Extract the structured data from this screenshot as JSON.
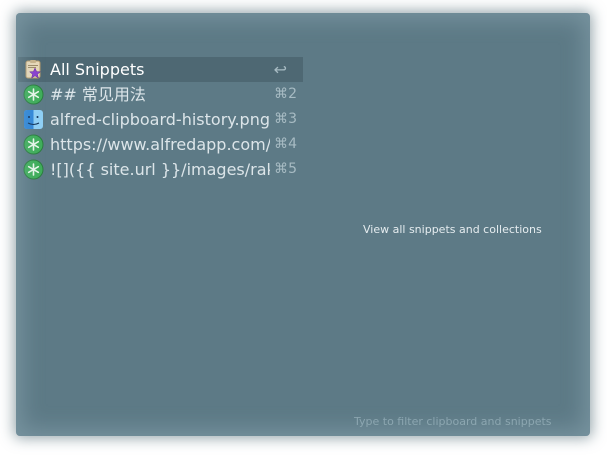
{
  "results": [
    {
      "title": "All Snippets",
      "shortcut": "↩",
      "icon": "snippets-clipboard-star-icon",
      "selected": true
    },
    {
      "title": "## 常见用法",
      "shortcut": "⌘2",
      "icon": "snippet-asterisk-icon",
      "selected": false
    },
    {
      "title": "alfred-clipboard-history.png",
      "shortcut": "⌘3",
      "icon": "finder-icon",
      "selected": false
    },
    {
      "title": "https://www.alfredapp.com/",
      "shortcut": "⌘4",
      "icon": "snippet-asterisk-icon",
      "selected": false
    },
    {
      "title": "![]({{ site.url }}/images/rake-...",
      "shortcut": "⌘5",
      "icon": "snippet-asterisk-icon",
      "selected": false
    }
  ],
  "preview": {
    "text": "View all snippets and collections"
  },
  "footer": {
    "hint": "Type to filter clipboard and snippets"
  },
  "colors": {
    "background": "#5d7a86",
    "selected_row": "#4e6873",
    "text": "#dce5e9",
    "snippet_icon_green": "#3fae5a",
    "clipboard_purple_star": "#8a3fd0"
  }
}
